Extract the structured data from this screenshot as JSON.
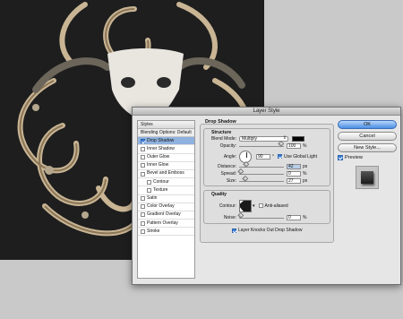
{
  "dialog": {
    "title": "Layer Style"
  },
  "styles_panel": {
    "header": "Styles",
    "blending_label": "Blending Options: Default",
    "items": [
      {
        "label": "Drop Shadow",
        "checked": true,
        "selected": true,
        "sub": false
      },
      {
        "label": "Inner Shadow",
        "checked": false,
        "selected": false,
        "sub": false
      },
      {
        "label": "Outer Glow",
        "checked": false,
        "selected": false,
        "sub": false
      },
      {
        "label": "Inner Glow",
        "checked": false,
        "selected": false,
        "sub": false
      },
      {
        "label": "Bevel and Emboss",
        "checked": false,
        "selected": false,
        "sub": false
      },
      {
        "label": "Contour",
        "checked": false,
        "selected": false,
        "sub": true
      },
      {
        "label": "Texture",
        "checked": false,
        "selected": false,
        "sub": true
      },
      {
        "label": "Satin",
        "checked": false,
        "selected": false,
        "sub": false
      },
      {
        "label": "Color Overlay",
        "checked": false,
        "selected": false,
        "sub": false
      },
      {
        "label": "Gradient Overlay",
        "checked": false,
        "selected": false,
        "sub": false
      },
      {
        "label": "Pattern Overlay",
        "checked": false,
        "selected": false,
        "sub": false
      },
      {
        "label": "Stroke",
        "checked": false,
        "selected": false,
        "sub": false
      }
    ]
  },
  "drop_shadow": {
    "title": "Drop Shadow",
    "structure": {
      "title": "Structure",
      "blend_mode_label": "Blend Mode:",
      "blend_mode_value": "Multiply",
      "blend_color": "#000000",
      "opacity_label": "Opacity:",
      "opacity_value": "100",
      "opacity_unit": "%",
      "angle_label": "Angle:",
      "angle_value": "90",
      "angle_unit": "°",
      "global_light_label": "Use Global Light",
      "distance_label": "Distance:",
      "distance_value": "42",
      "distance_unit": "px",
      "spread_label": "Spread:",
      "spread_value": "0",
      "spread_unit": "%",
      "size_label": "Size:",
      "size_value": "27",
      "size_unit": "px"
    },
    "quality": {
      "title": "Quality",
      "contour_label": "Contour:",
      "anti_aliased_label": "Anti-aliased",
      "noise_label": "Noise:",
      "noise_value": "0",
      "noise_unit": "%"
    },
    "knockout_label": "Layer Knocks Out Drop Shadow"
  },
  "buttons": {
    "ok": "OK",
    "cancel": "Cancel",
    "new_style": "New Style...",
    "preview": "Preview"
  },
  "levels": {
    "opacity": 1.0,
    "distance": 0.14,
    "spread": 0.0,
    "size": 0.11,
    "noise": 0.0
  },
  "colors": {
    "accent": "#3d7fd9",
    "canvas": "#1e1e1e",
    "ornament": "#c9b594"
  }
}
